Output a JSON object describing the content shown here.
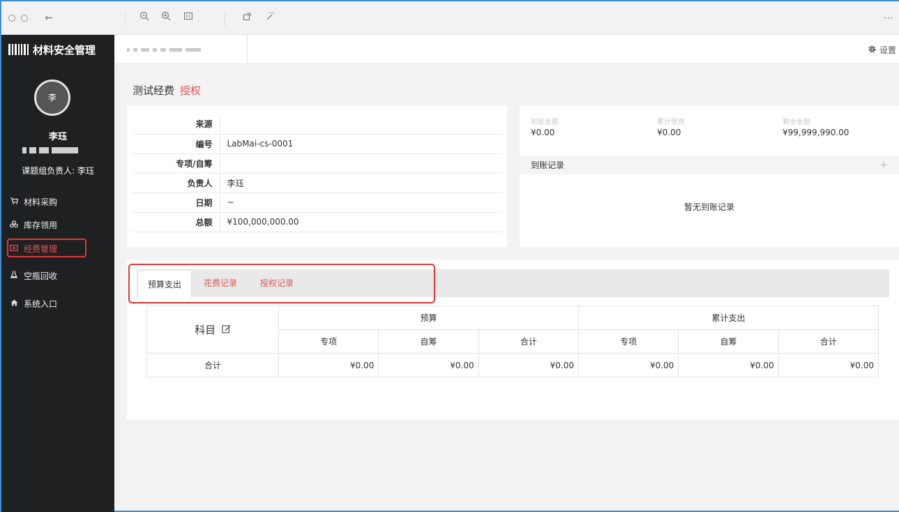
{
  "viewer": {
    "icons": [
      "close-icon",
      "minimize-icon",
      "back-arrow-icon",
      "zoom-out-icon",
      "zoom-in-icon",
      "fit-icon",
      "rotate-icon",
      "magic-wand-icon",
      "more-icon"
    ],
    "more_label": "⋯"
  },
  "sidebar": {
    "brand": "材料安全管理",
    "avatar_letter": "李",
    "user_name": "李珏",
    "role": "课题组负责人: 李珏",
    "items": [
      {
        "label": "材料采购",
        "icon": "cart-icon",
        "active": false
      },
      {
        "label": "库存领用",
        "icon": "boxes-icon",
        "active": false
      },
      {
        "label": "经费管理",
        "icon": "money-icon",
        "active": true
      },
      {
        "label": "空瓶回收",
        "icon": "flask-icon",
        "active": false
      },
      {
        "label": "系统入口",
        "icon": "home-icon",
        "active": false
      }
    ]
  },
  "topbar": {
    "settings_label": "设置"
  },
  "page": {
    "title": "测试经费",
    "title_accent": "授权"
  },
  "info": {
    "rows": [
      {
        "key": "来源",
        "value": ""
      },
      {
        "key": "编号",
        "value": "LabMai-cs-0001"
      },
      {
        "key": "专项/自筹",
        "value": ""
      },
      {
        "key": "负责人",
        "value": "李珏"
      },
      {
        "key": "日期",
        "value": "~"
      },
      {
        "key": "总额",
        "value": "¥100,000,000.00"
      }
    ]
  },
  "stats": {
    "arrived": {
      "label": "到账金额",
      "value": "¥0.00"
    },
    "used": {
      "label": "累计使用",
      "value": "¥0.00"
    },
    "remaining": {
      "label": "剩余金额",
      "value": "¥99,999,990.00"
    },
    "arrivals_title": "到账记录",
    "arrivals_add": "+",
    "arrivals_empty": "暂无到账记录"
  },
  "budget": {
    "tabs": [
      "预算支出",
      "花费记录",
      "授权记录"
    ],
    "subject_header": "科目",
    "group_budget": "预算",
    "group_spent": "累计支出",
    "sub_headers": [
      "专项",
      "自筹",
      "合计",
      "专项",
      "自筹",
      "合计"
    ],
    "total_row": {
      "label": "合计",
      "values": [
        "¥0.00",
        "¥0.00",
        "¥0.00",
        "¥0.00",
        "¥0.00",
        "¥0.00"
      ]
    }
  }
}
